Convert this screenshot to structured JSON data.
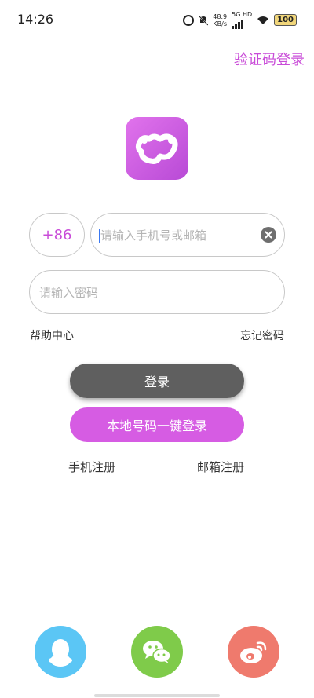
{
  "status_bar": {
    "time": "14:26",
    "net_speed_value": "48.9",
    "net_speed_unit": "KB/s",
    "network_type": "5G HD",
    "battery": "100"
  },
  "top_link": "验证码登录",
  "form": {
    "country_code": "+86",
    "phone_placeholder": "请输入手机号或邮箱",
    "password_placeholder": "请输入密码",
    "help_label": "帮助中心",
    "forgot_label": "忘记密码",
    "login_label": "登录",
    "onekey_label": "本地号码一键登录",
    "register_phone_label": "手机注册",
    "register_email_label": "邮箱注册"
  },
  "social": [
    "qq-icon",
    "wechat-icon",
    "weibo-icon"
  ],
  "colors": {
    "accent": "#c94cd8",
    "login_button": "#5f5f5f",
    "onekey_button": "#d65ce3",
    "qq": "#5bc6f5",
    "wechat": "#7fcb4a",
    "weibo": "#ef7a6d"
  }
}
